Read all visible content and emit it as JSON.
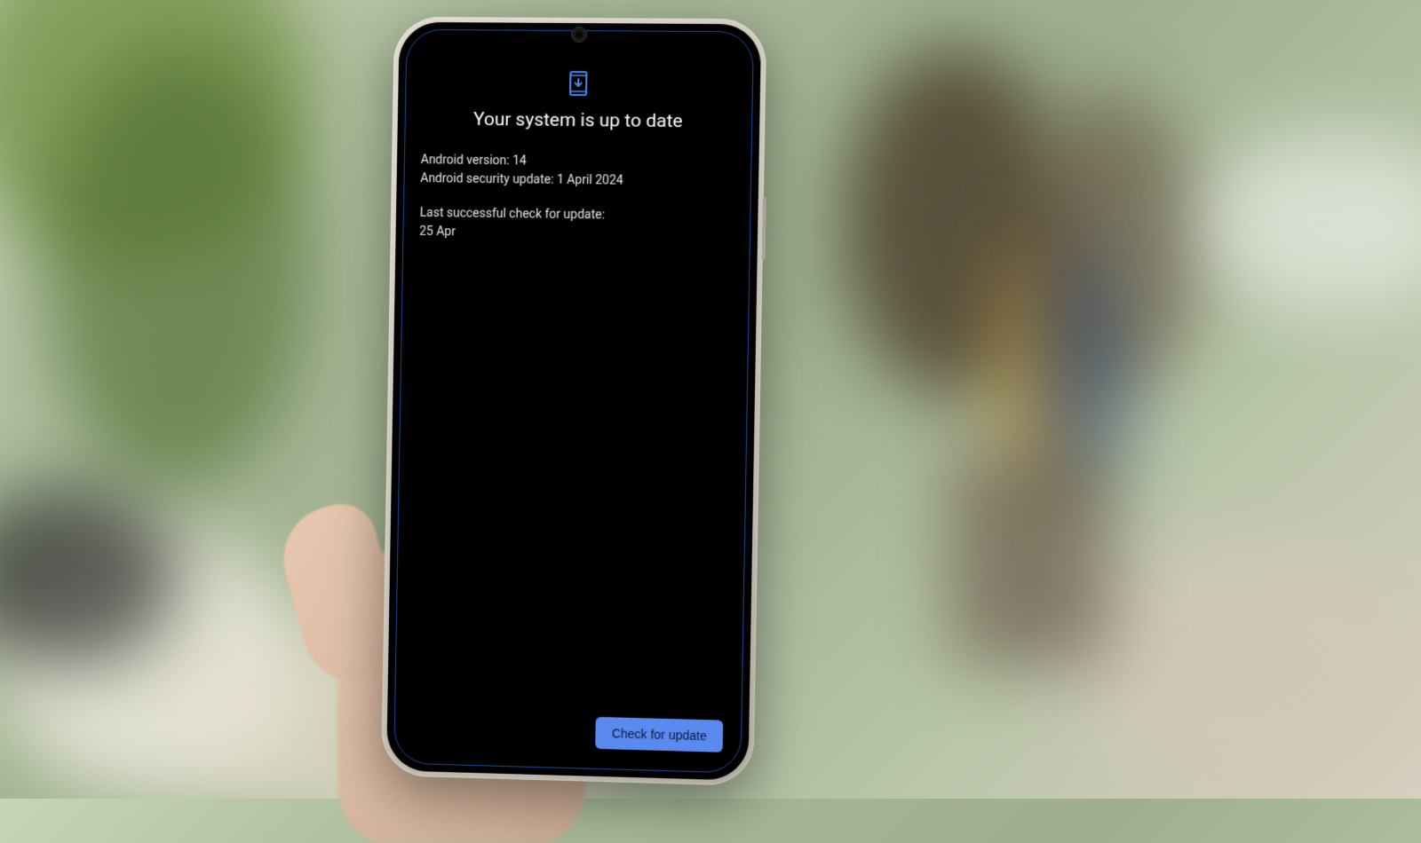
{
  "system_update": {
    "title": "Your system is up to date",
    "android_version_label": "Android version:",
    "android_version_value": "14",
    "security_update_label": "Android security update:",
    "security_update_value": "1 April 2024",
    "last_check_label": "Last successful check for update:",
    "last_check_value": "25 Apr",
    "check_button_label": "Check for update"
  },
  "colors": {
    "accent": "#5a8af0",
    "screen_bg": "#000000",
    "text_primary": "#ffffff"
  }
}
